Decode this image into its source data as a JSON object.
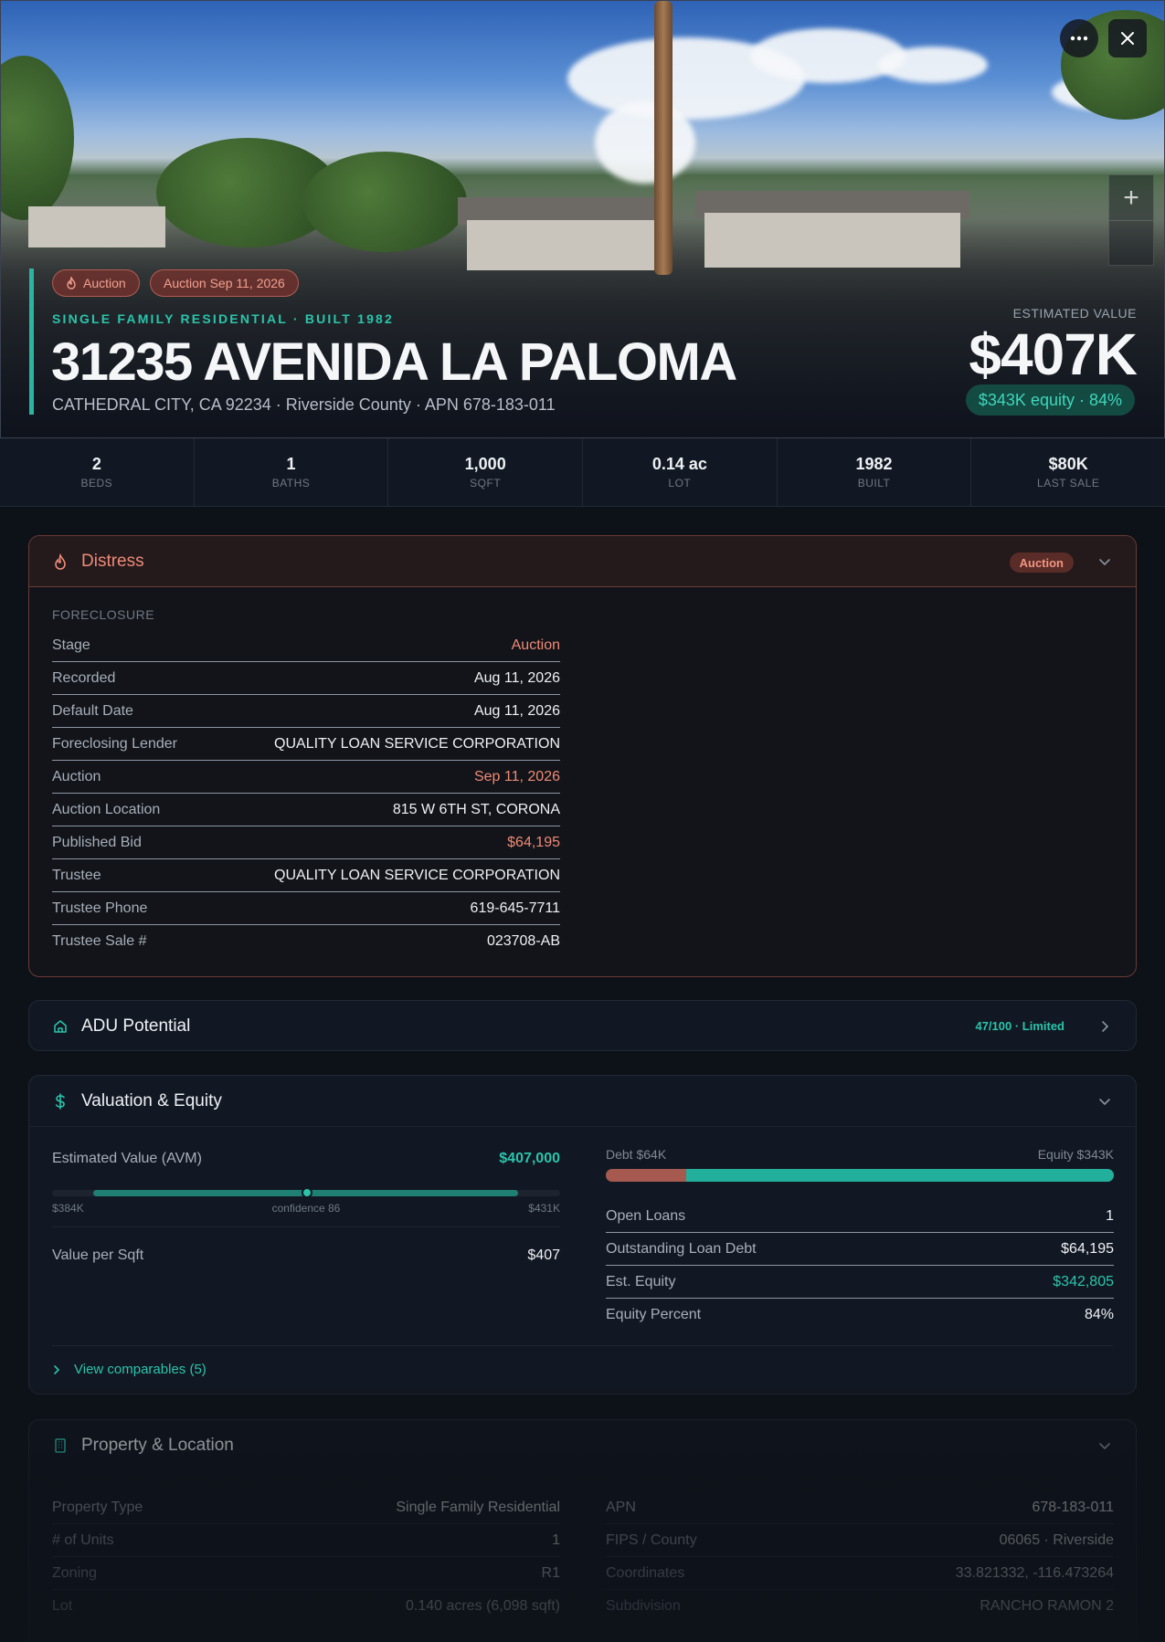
{
  "hero": {
    "badge_auction": "Auction",
    "badge_auction_date": "Auction Sep 11, 2026",
    "subtitle": "SINGLE FAMILY RESIDENTIAL · BUILT 1982",
    "address": "31235 AVENIDA LA PALOMA",
    "location": "CATHEDRAL CITY, CA 92234 · Riverside County · APN 678-183-011",
    "estimated_value_label": "ESTIMATED VALUE",
    "estimated_value": "$407K",
    "equity_pill": "$343K equity · 84%"
  },
  "stats": [
    {
      "value": "2",
      "label": "BEDS"
    },
    {
      "value": "1",
      "label": "BATHS"
    },
    {
      "value": "1,000",
      "label": "SQFT"
    },
    {
      "value": "0.14 ac",
      "label": "LOT"
    },
    {
      "value": "1982",
      "label": "BUILT"
    },
    {
      "value": "$80K",
      "label": "LAST SALE"
    }
  ],
  "distress": {
    "title": "Distress",
    "badge": "Auction",
    "section_label": "FORECLOSURE",
    "rows": [
      {
        "k": "Stage",
        "v": "Auction"
      },
      {
        "k": "Recorded",
        "v": "Aug 11, 2026"
      },
      {
        "k": "Default Date",
        "v": "Aug 11, 2026"
      },
      {
        "k": "Foreclosing Lender",
        "v": "QUALITY LOAN SERVICE CORPORATION"
      },
      {
        "k": "Auction",
        "v": "Sep 11, 2026"
      },
      {
        "k": "Auction Location",
        "v": "815 W 6TH ST, CORONA"
      },
      {
        "k": "Published Bid",
        "v": "$64,195"
      },
      {
        "k": "Trustee",
        "v": "QUALITY LOAN SERVICE CORPORATION"
      },
      {
        "k": "Trustee Phone",
        "v": "619-645-7711"
      },
      {
        "k": "Trustee Sale #",
        "v": "023708-AB"
      }
    ]
  },
  "adu": {
    "title": "ADU Potential",
    "score": "47/100 · Limited"
  },
  "valuation": {
    "title": "Valuation & Equity",
    "avm_label": "Estimated Value (AVM)",
    "avm_value": "$407,000",
    "range_low": "$384K",
    "range_confidence": "confidence 86",
    "range_high": "$431K",
    "value_per_sqft_label": "Value per Sqft",
    "value_per_sqft": "$407",
    "debt_label": "Debt $64K",
    "equity_label": "Equity $343K",
    "debt_fraction": 0.158,
    "rows": [
      {
        "k": "Open Loans",
        "v": "1"
      },
      {
        "k": "Outstanding Loan Debt",
        "v": "$64,195"
      },
      {
        "k": "Est. Equity",
        "v": "$342,805"
      },
      {
        "k": "Equity Percent",
        "v": "84%"
      }
    ],
    "comparables_link": "View comparables (5)"
  },
  "property": {
    "title": "Property & Location",
    "left_rows": [
      {
        "k": "Property Type",
        "v": "Single Family Residential"
      },
      {
        "k": "# of Units",
        "v": "1"
      },
      {
        "k": "Zoning",
        "v": "R1"
      },
      {
        "k": "Lot",
        "v": "0.140 acres (6,098 sqft)"
      }
    ],
    "right_rows": [
      {
        "k": "APN",
        "v": "678-183-011"
      },
      {
        "k": "FIPS / County",
        "v": "06065 · Riverside"
      },
      {
        "k": "Coordinates",
        "v": "33.821332, -116.473264"
      },
      {
        "k": "Subdivision",
        "v": "RANCHO RAMON 2"
      }
    ]
  },
  "colors": {
    "accent_teal": "#2bc4ab",
    "distress_red": "#ef8a76",
    "background": "#0d1118"
  }
}
